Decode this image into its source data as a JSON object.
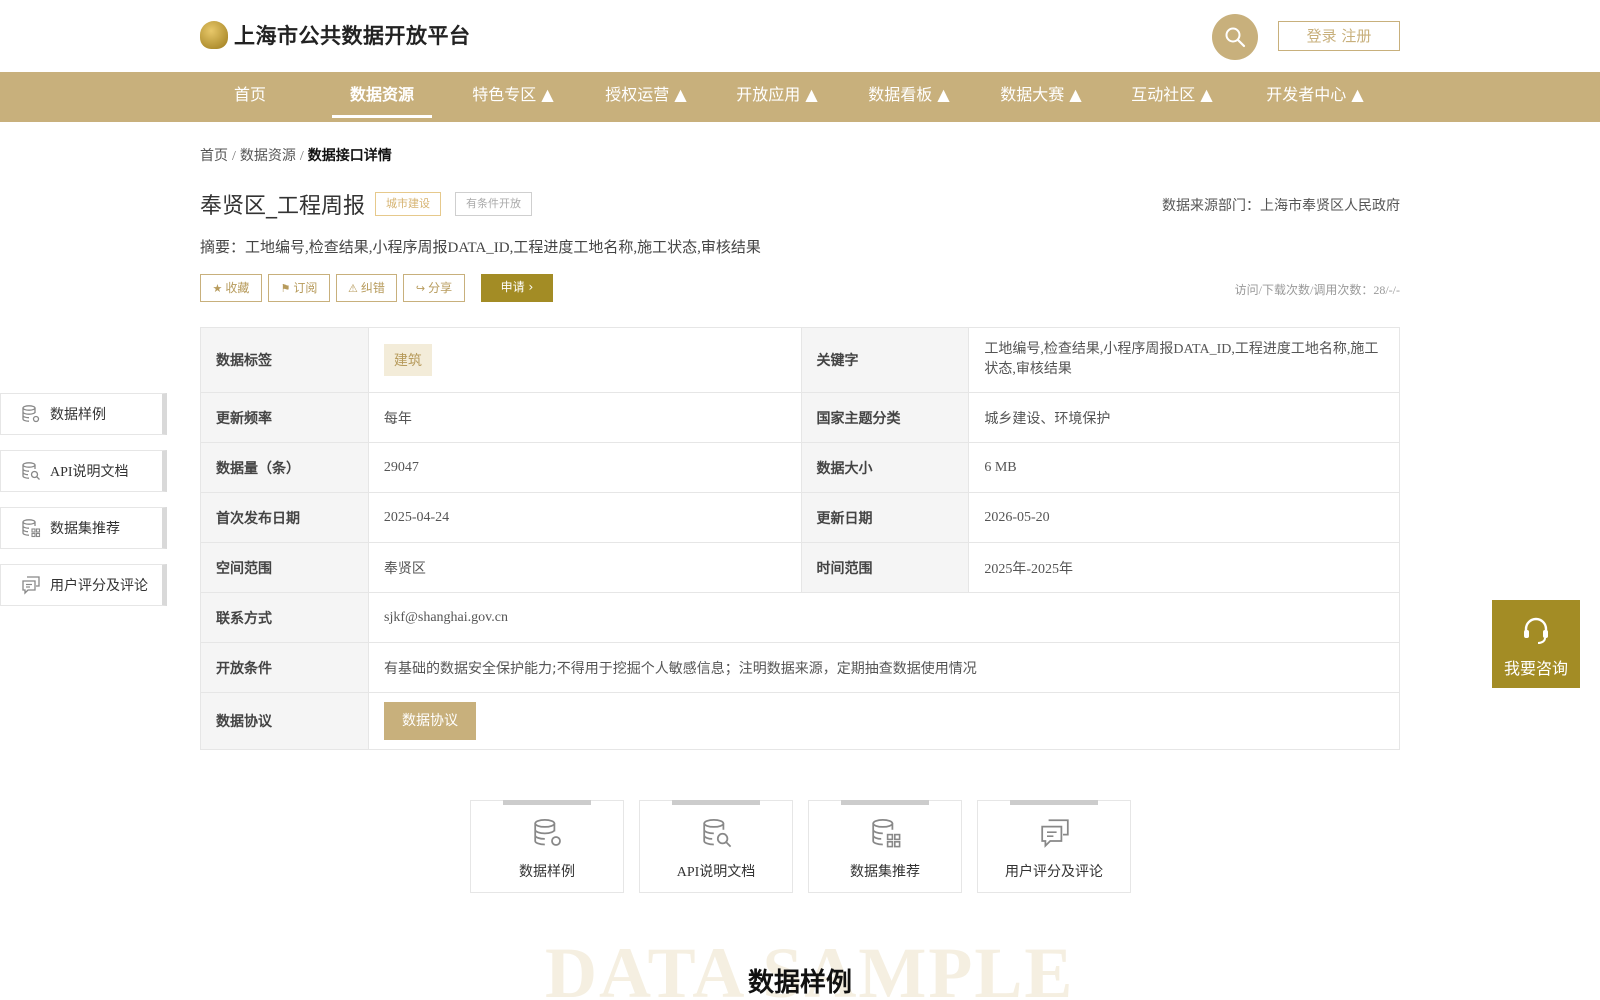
{
  "header": {
    "site_title": "上海市公共数据开放平台",
    "login_label": "登录 注册"
  },
  "nav": {
    "items": [
      {
        "label": "首页"
      },
      {
        "label": "数据资源"
      },
      {
        "label": "特色专区 ▲"
      },
      {
        "label": "授权运营 ▲"
      },
      {
        "label": "开放应用 ▲"
      },
      {
        "label": "数据看板 ▲"
      },
      {
        "label": "数据大赛 ▲"
      },
      {
        "label": "互动社区 ▲"
      },
      {
        "label": "开发者中心 ▲"
      }
    ],
    "active": "数据资源"
  },
  "breadcrumb": {
    "items": [
      "首页",
      "数据资源",
      "数据接口详情"
    ],
    "separator": "/"
  },
  "dataset": {
    "title": "奉贤区_工程周报",
    "tag_category": "城市建设",
    "tag_open": "有条件开放",
    "source": "数据来源部门：上海市奉贤区人民政府",
    "summary": "摘要：工地编号,检查结果,小程序周报DATA_ID,工程进度工地名称,施工状态,审核结果",
    "visits": "访问/下载次数/调用次数：28/-/-"
  },
  "actions": {
    "collect": "收藏",
    "subscribe": "订阅",
    "correct": "纠错",
    "share": "分享",
    "apply": "申请"
  },
  "info": {
    "tag_label": "数据标签",
    "tag_value": "建筑",
    "keyword_label": "关键字",
    "keyword_value": "工地编号,检查结果,小程序周报DATA_ID,工程进度工地名称,施工状态,审核结果",
    "freq_label": "更新频率",
    "freq_value": "每年",
    "theme_label": "国家主题分类",
    "theme_value": "城乡建设、环境保护",
    "count_label": "数据量（条）",
    "count_value": "29047",
    "size_label": "数据大小",
    "size_value": "6 MB",
    "first_label": "首次发布日期",
    "first_value": "2025-04-24",
    "update_label": "更新日期",
    "update_value": "2026-05-20",
    "space_label": "空间范围",
    "space_value": "奉贤区",
    "time_label": "时间范围",
    "time_value": "2025年-2025年",
    "contact_label": "联系方式",
    "contact_value": "sjkf@shanghai.gov.cn",
    "cond_label": "开放条件",
    "cond_value": "有基础的数据安全保护能力;不得用于挖掘个人敏感信息；注明数据来源，定期抽查数据使用情况",
    "protocol_label": "数据协议",
    "protocol_button": "数据协议"
  },
  "side_nav": {
    "items": [
      {
        "label": "数据样例",
        "icon": "database-gear-icon"
      },
      {
        "label": "API说明文档",
        "icon": "database-search-icon"
      },
      {
        "label": "数据集推荐",
        "icon": "database-grid-icon"
      },
      {
        "label": "用户评分及评论",
        "icon": "comment-icon"
      }
    ]
  },
  "consult": {
    "label": "我要咨询",
    "icon": "headset-icon"
  },
  "cards": {
    "items": [
      {
        "label": "数据样例",
        "icon": "database-gear-icon"
      },
      {
        "label": "API说明文档",
        "icon": "database-search-icon"
      },
      {
        "label": "数据集推荐",
        "icon": "database-grid-icon"
      },
      {
        "label": "用户评分及评论",
        "icon": "comment-icon"
      }
    ]
  },
  "section": {
    "background_word": "DATA SAMPLE",
    "title": "数据样例"
  },
  "colors": {
    "brand": "#c8b07c",
    "accent": "#a38c25",
    "label_bg": "#f5f5f5"
  }
}
